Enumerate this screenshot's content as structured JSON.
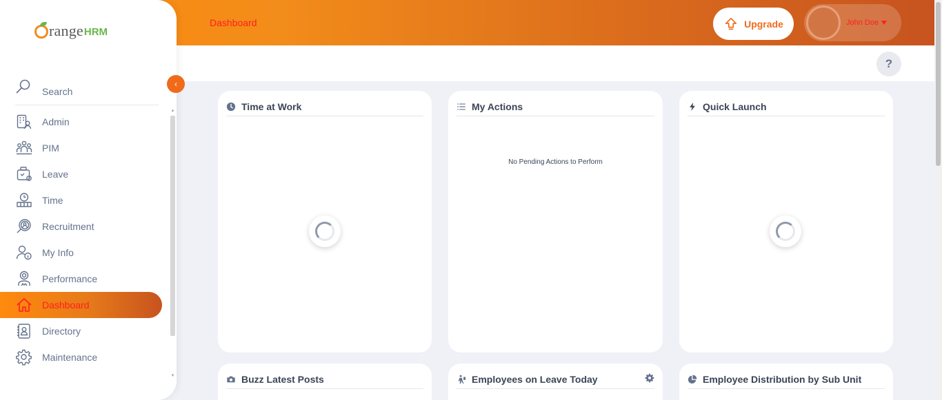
{
  "header": {
    "title": "Dashboard",
    "upgrade_label": "Upgrade",
    "user_name": "John Doe",
    "help_label": "?"
  },
  "brand": {
    "logo_range": "range",
    "logo_hrm": "HRM",
    "orange": "#ff8a0e",
    "dark_orange": "#c7531f",
    "active_text": "#ff1f1f"
  },
  "sidebar": {
    "search_label": "Search",
    "items": [
      {
        "label": "Admin",
        "icon": "admin-icon"
      },
      {
        "label": "PIM",
        "icon": "pim-icon"
      },
      {
        "label": "Leave",
        "icon": "leave-icon"
      },
      {
        "label": "Time",
        "icon": "time-icon"
      },
      {
        "label": "Recruitment",
        "icon": "recruitment-icon"
      },
      {
        "label": "My Info",
        "icon": "my-info-icon"
      },
      {
        "label": "Performance",
        "icon": "performance-icon"
      },
      {
        "label": "Dashboard",
        "icon": "home-icon",
        "active": true
      },
      {
        "label": "Directory",
        "icon": "directory-icon"
      },
      {
        "label": "Maintenance",
        "icon": "maintenance-icon"
      }
    ]
  },
  "cards": {
    "time_at_work": {
      "title": "Time at Work",
      "icon": "clock-icon"
    },
    "my_actions": {
      "title": "My Actions",
      "icon": "list-icon",
      "empty_text": "No Pending Actions to Perform"
    },
    "quick_launch": {
      "title": "Quick Launch",
      "icon": "bolt-icon"
    },
    "buzz": {
      "title": "Buzz Latest Posts",
      "icon": "camera-icon"
    },
    "leave_today": {
      "title": "Employees on Leave Today",
      "icon": "leave-person-icon"
    },
    "distribution": {
      "title": "Employee Distribution by Sub Unit",
      "icon": "pie-icon"
    }
  }
}
